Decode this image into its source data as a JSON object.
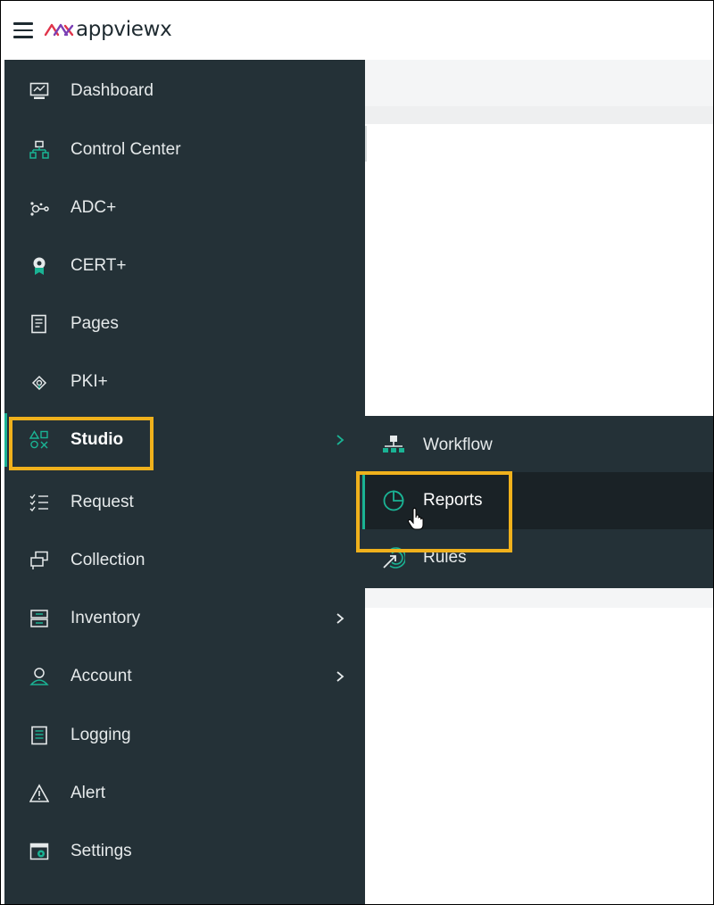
{
  "app": {
    "brand": "appviewx"
  },
  "sidebar": {
    "items": [
      {
        "label": "Dashboard",
        "icon": "monitor-icon"
      },
      {
        "label": "Control Center",
        "icon": "network-icon"
      },
      {
        "label": "ADC+",
        "icon": "adc-node-icon"
      },
      {
        "label": "CERT+",
        "icon": "certificate-badge-icon"
      },
      {
        "label": "Pages",
        "icon": "page-icon"
      },
      {
        "label": "PKI+",
        "icon": "pki-icon"
      },
      {
        "label": "Studio",
        "icon": "shapes-icon",
        "has_submenu": true,
        "active": true
      },
      {
        "label": "Request",
        "icon": "checklist-icon"
      },
      {
        "label": "Collection",
        "icon": "collection-icon"
      },
      {
        "label": "Inventory",
        "icon": "inventory-icon",
        "has_submenu": true
      },
      {
        "label": "Account",
        "icon": "user-icon",
        "has_submenu": true
      },
      {
        "label": "Logging",
        "icon": "log-icon"
      },
      {
        "label": "Alert",
        "icon": "warning-icon"
      },
      {
        "label": "Settings",
        "icon": "settings-window-icon"
      }
    ]
  },
  "submenu": {
    "items": [
      {
        "label": "Workflow",
        "icon": "workflow-icon"
      },
      {
        "label": "Reports",
        "icon": "pie-chart-icon",
        "active": true
      },
      {
        "label": "Rules",
        "icon": "rules-icon"
      }
    ]
  },
  "colors": {
    "sidebar_bg": "#243137",
    "active_bg": "#1a2226",
    "accent": "#1ab394",
    "highlight": "#f0b11c",
    "text": "#e6eaeb"
  }
}
